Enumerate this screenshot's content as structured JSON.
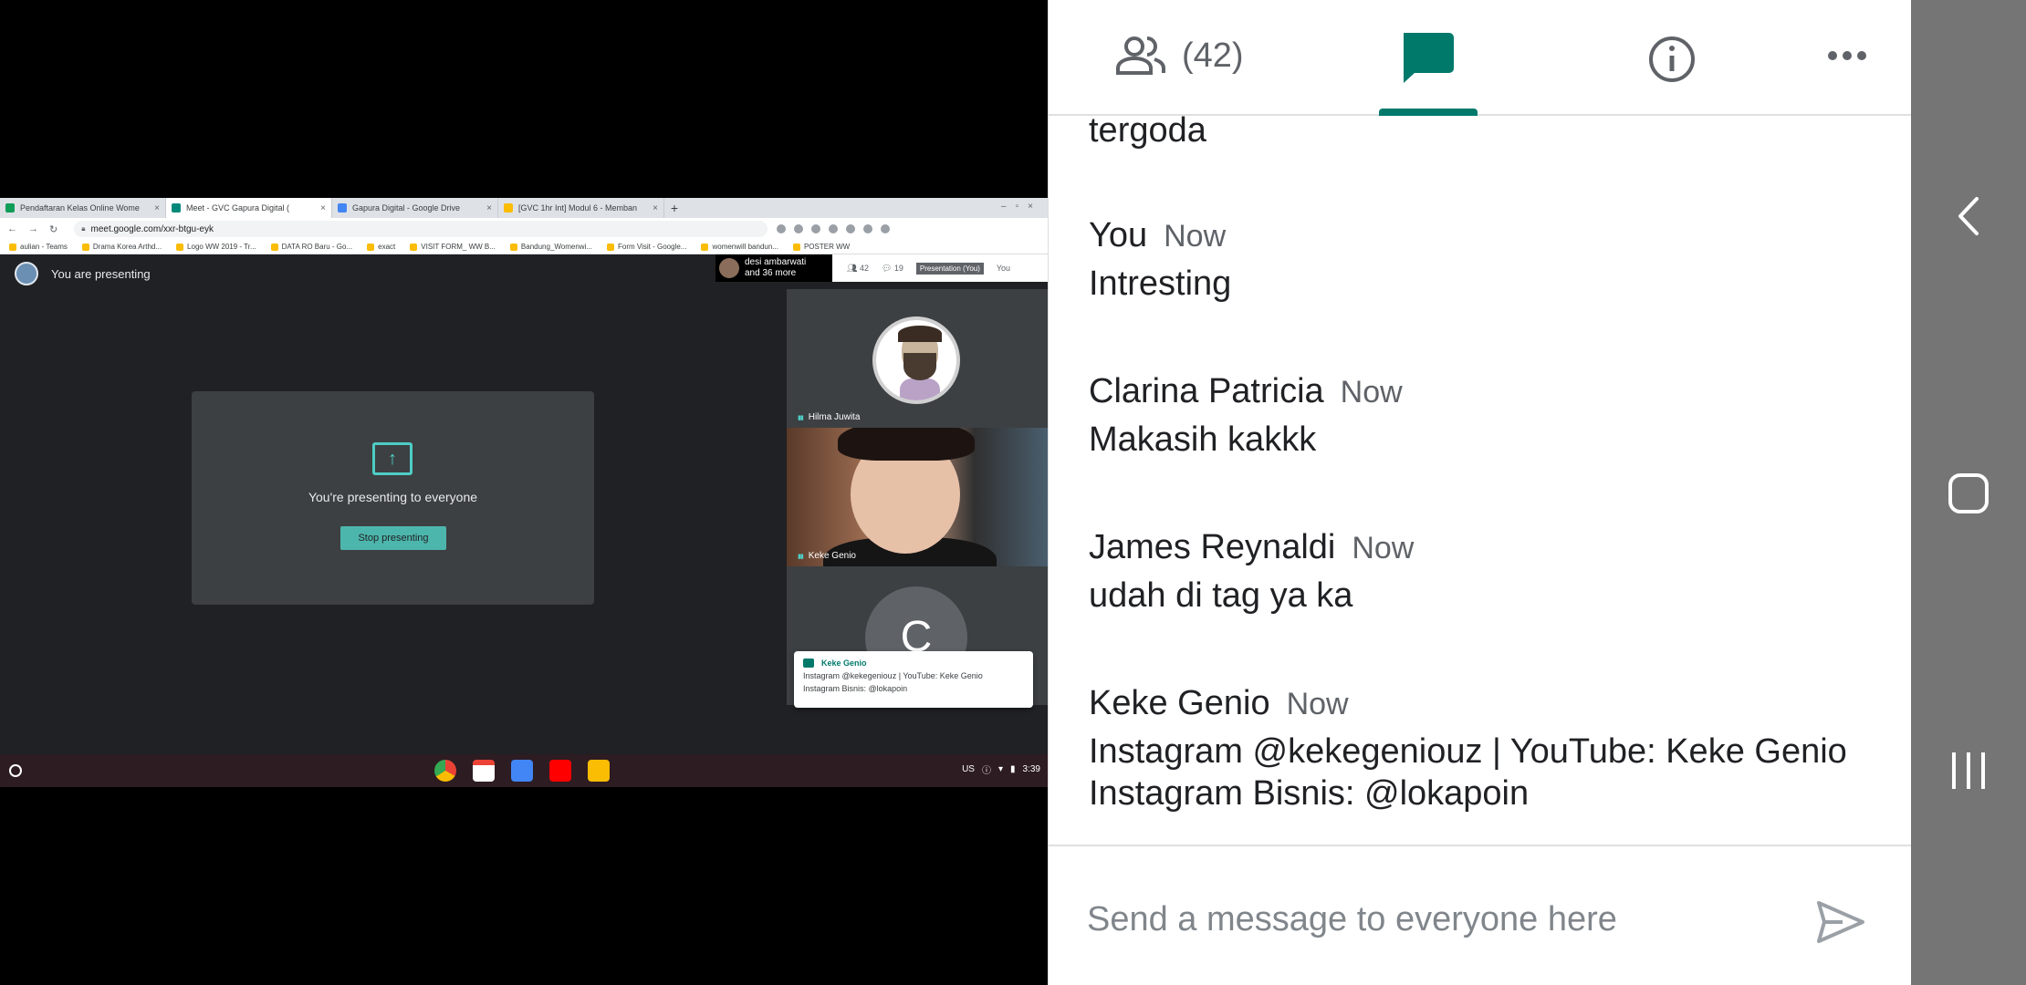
{
  "browser": {
    "tabs": [
      {
        "label": "Pendaftaran Kelas Online Wome",
        "color": "#0f9d58"
      },
      {
        "label": "Meet - GVC Gapura Digital (",
        "color": "#00897b"
      },
      {
        "label": "Gapura Digital - Google Drive",
        "color": "#4285f4"
      },
      {
        "label": "[GVC 1hr Int] Modul 6 - Memban",
        "color": "#fbbc04"
      }
    ],
    "new_tab": "+",
    "url": "meet.google.com/xxr-btgu-eyk",
    "bookmarks": [
      "aulian - Teams",
      "Drama Korea Arthd...",
      "Logo WW 2019 - Tr...",
      "DATA RO Baru - Go...",
      "exact",
      "VISIT FORM_ WW B...",
      "Bandung_Womenwi...",
      "Form Visit - Google...",
      "womenwill bandun...",
      "POSTER WW"
    ]
  },
  "meet": {
    "presenting_label": "You are presenting",
    "top_names": "desi ambarwati",
    "top_more": "and 36 more",
    "people_count": "42",
    "chat_count": "19",
    "presentation_label": "Presentation (You)",
    "you_label": "You",
    "present_title": "You're presenting to everyone",
    "stop_button": "Stop presenting",
    "tiles": [
      {
        "name": "Hilma Juwita"
      },
      {
        "name": "Keke Genio"
      },
      {
        "name": "",
        "initial": "C"
      }
    ],
    "toast": {
      "sender": "Keke Genio",
      "line1": "Instagram @kekegeniouz | YouTube: Keke Genio",
      "line2": "Instagram Bisnis: @lokapoin"
    },
    "shelf": {
      "locale": "US",
      "time": "3:39"
    }
  },
  "chat_panel": {
    "participants": "(42)",
    "partial_message": "tergoda",
    "messages": [
      {
        "sender": "You",
        "time": "Now",
        "text": "Intresting"
      },
      {
        "sender": "Clarina Patricia",
        "time": "Now",
        "text": "Makasih kakkk"
      },
      {
        "sender": "James Reynaldi",
        "time": "Now",
        "text": "udah di tag ya ka"
      },
      {
        "sender": "Keke Genio",
        "time": "Now",
        "text": "Instagram @kekegeniouz | YouTube: Keke Genio\nInstagram Bisnis: @lokapoin"
      }
    ],
    "input_placeholder": "Send a message to everyone here",
    "accent": "#00796b"
  }
}
